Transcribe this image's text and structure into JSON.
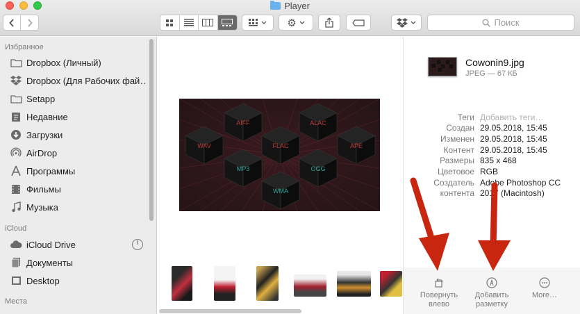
{
  "window": {
    "title": "Player"
  },
  "toolbar": {
    "search_placeholder": "Поиск"
  },
  "sidebar": {
    "favorites_header": "Избранное",
    "favorites": [
      {
        "label": "Dropbox (Личный)",
        "icon": "folder-icon"
      },
      {
        "label": "Dropbox (Для Рабочих фай…",
        "icon": "dropbox-icon"
      },
      {
        "label": "Setapp",
        "icon": "folder-icon"
      },
      {
        "label": "Недавние",
        "icon": "recents-icon"
      },
      {
        "label": "Загрузки",
        "icon": "downloads-icon"
      },
      {
        "label": "AirDrop",
        "icon": "airdrop-icon"
      },
      {
        "label": "Программы",
        "icon": "applications-icon"
      },
      {
        "label": "Фильмы",
        "icon": "movies-icon"
      },
      {
        "label": "Музыка",
        "icon": "music-icon"
      }
    ],
    "icloud_header": "iCloud",
    "icloud": [
      {
        "label": "iCloud Drive",
        "icon": "cloud-icon"
      },
      {
        "label": "Документы",
        "icon": "documents-icon"
      },
      {
        "label": "Desktop",
        "icon": "desktop-icon"
      }
    ],
    "places_header": "Места"
  },
  "preview": {
    "cube_labels": [
      "AIFF",
      "ALAC",
      "WAV",
      "FLAC",
      "APE",
      "MP3",
      "OGG",
      "WMA"
    ]
  },
  "info": {
    "filename": "Cowonin9.jpg",
    "meta": "JPEG — 67 КБ",
    "rows": [
      {
        "key": "Теги",
        "value": "Добавить теги…",
        "placeholder": true
      },
      {
        "key": "Создан",
        "value": "29.05.2018, 15:45"
      },
      {
        "key": "Изменен",
        "value": "29.05.2018, 15:45"
      },
      {
        "key": "Контент",
        "value": "29.05.2018, 15:45"
      },
      {
        "key": "Размеры",
        "value": "835 x 468"
      },
      {
        "key": "Цветовое",
        "value": "RGB"
      },
      {
        "key": "Создатель",
        "value": "Adobe Photoshop CC"
      },
      {
        "key": "контента",
        "value": "2017 (Macintosh)"
      }
    ],
    "actions": [
      {
        "line1": "Повернуть",
        "line2": "влево"
      },
      {
        "line1": "Добавить",
        "line2": "разметку"
      },
      {
        "line1": "More…",
        "line2": ""
      }
    ]
  },
  "colors": {
    "arrow": "#c8260f",
    "sidebar_bg": "#ececec",
    "cube_label": "#c03a3a",
    "cube_label_alt": "#2fa49a"
  }
}
